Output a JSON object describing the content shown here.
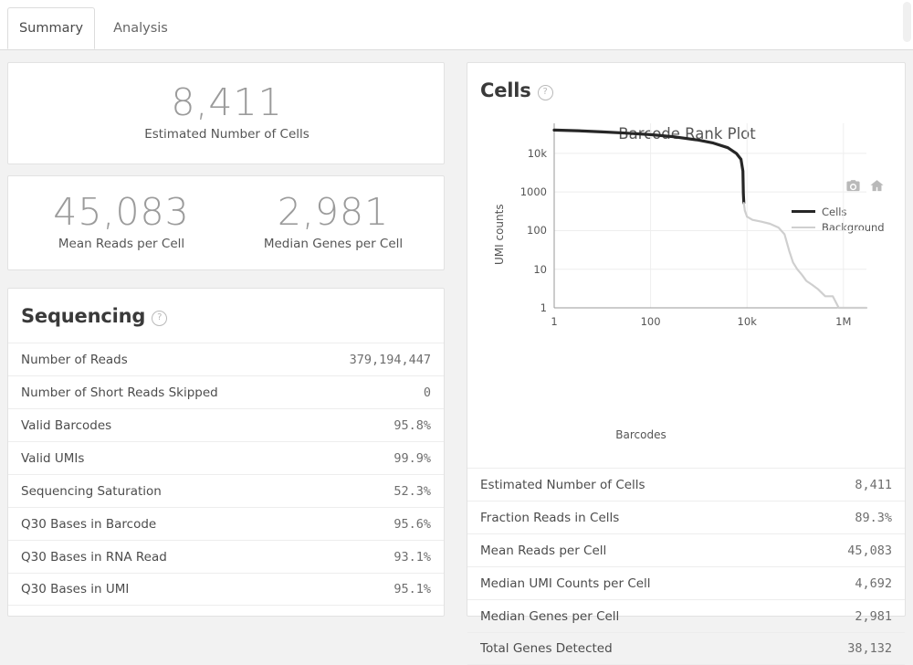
{
  "tabs": [
    {
      "label": "Summary",
      "active": true
    },
    {
      "label": "Analysis",
      "active": false
    }
  ],
  "top_metrics": {
    "estimated_cells": {
      "value": "8,411",
      "label": "Estimated Number of Cells"
    },
    "mean_reads": {
      "value": "45,083",
      "label": "Mean Reads per Cell"
    },
    "median_genes": {
      "value": "2,981",
      "label": "Median Genes per Cell"
    }
  },
  "sequencing": {
    "title": "Sequencing",
    "help_icon": "question-mark-circle-icon",
    "rows": [
      {
        "key": "Number of Reads",
        "value": "379,194,447"
      },
      {
        "key": "Number of Short Reads Skipped",
        "value": "0"
      },
      {
        "key": "Valid Barcodes",
        "value": "95.8%"
      },
      {
        "key": "Valid UMIs",
        "value": "99.9%"
      },
      {
        "key": "Sequencing Saturation",
        "value": "52.3%"
      },
      {
        "key": "Q30 Bases in Barcode",
        "value": "95.6%"
      },
      {
        "key": "Q30 Bases in RNA Read",
        "value": "93.1%"
      },
      {
        "key": "Q30 Bases in UMI",
        "value": "95.1%"
      }
    ]
  },
  "cells": {
    "title": "Cells",
    "help_icon": "question-mark-circle-icon",
    "rows": [
      {
        "key": "Estimated Number of Cells",
        "value": "8,411"
      },
      {
        "key": "Fraction Reads in Cells",
        "value": "89.3%"
      },
      {
        "key": "Mean Reads per Cell",
        "value": "45,083"
      },
      {
        "key": "Median UMI Counts per Cell",
        "value": "4,692"
      },
      {
        "key": "Median Genes per Cell",
        "value": "2,981"
      },
      {
        "key": "Total Genes Detected",
        "value": "38,132"
      }
    ]
  },
  "modebar": {
    "buttons": [
      {
        "name": "camera-icon",
        "title": "Download plot as a png"
      },
      {
        "name": "home-icon",
        "title": "Reset axes"
      }
    ]
  },
  "colors": {
    "cells_line": "#262626",
    "background_line": "#cfcfcf",
    "grid": "#eeeeee",
    "axis": "#888888",
    "metric_value": "#9b9b9b",
    "card_border": "#e2e2e2"
  },
  "chart_data": {
    "type": "line",
    "title": "Barcode Rank Plot",
    "xlabel": "Barcodes",
    "ylabel": "UMI counts",
    "xscale": "log",
    "yscale": "log",
    "xlim": [
      1,
      3000000
    ],
    "ylim": [
      1,
      60000
    ],
    "xticks": [
      "1",
      "100",
      "10k",
      "1M"
    ],
    "xtick_values": [
      1,
      100,
      10000,
      1000000
    ],
    "yticks": [
      "1",
      "10",
      "100",
      "1000",
      "10k"
    ],
    "ytick_values": [
      1,
      10,
      100,
      1000,
      10000
    ],
    "grid": true,
    "legend_position": "top-right",
    "series": [
      {
        "name": "Cells",
        "color": "#262626",
        "points": [
          [
            1,
            40000
          ],
          [
            3,
            38500
          ],
          [
            10,
            36000
          ],
          [
            30,
            33500
          ],
          [
            100,
            30500
          ],
          [
            300,
            27000
          ],
          [
            1000,
            22000
          ],
          [
            2000,
            18500
          ],
          [
            4000,
            14000
          ],
          [
            6000,
            10000
          ],
          [
            7500,
            7000
          ],
          [
            8200,
            3500
          ],
          [
            8411,
            900
          ],
          [
            8600,
            520
          ]
        ]
      },
      {
        "name": "Background",
        "color": "#cfcfcf",
        "points": [
          [
            8600,
            520
          ],
          [
            9000,
            330
          ],
          [
            10000,
            230
          ],
          [
            13000,
            190
          ],
          [
            20000,
            170
          ],
          [
            30000,
            150
          ],
          [
            45000,
            120
          ],
          [
            60000,
            80
          ],
          [
            75000,
            30
          ],
          [
            90000,
            15
          ],
          [
            110000,
            10
          ],
          [
            140000,
            7
          ],
          [
            170000,
            5
          ],
          [
            220000,
            4
          ],
          [
            300000,
            3
          ],
          [
            420000,
            2
          ],
          [
            600000,
            2
          ],
          [
            800000,
            1
          ],
          [
            1400000,
            1
          ],
          [
            3000000,
            1
          ]
        ]
      }
    ]
  }
}
